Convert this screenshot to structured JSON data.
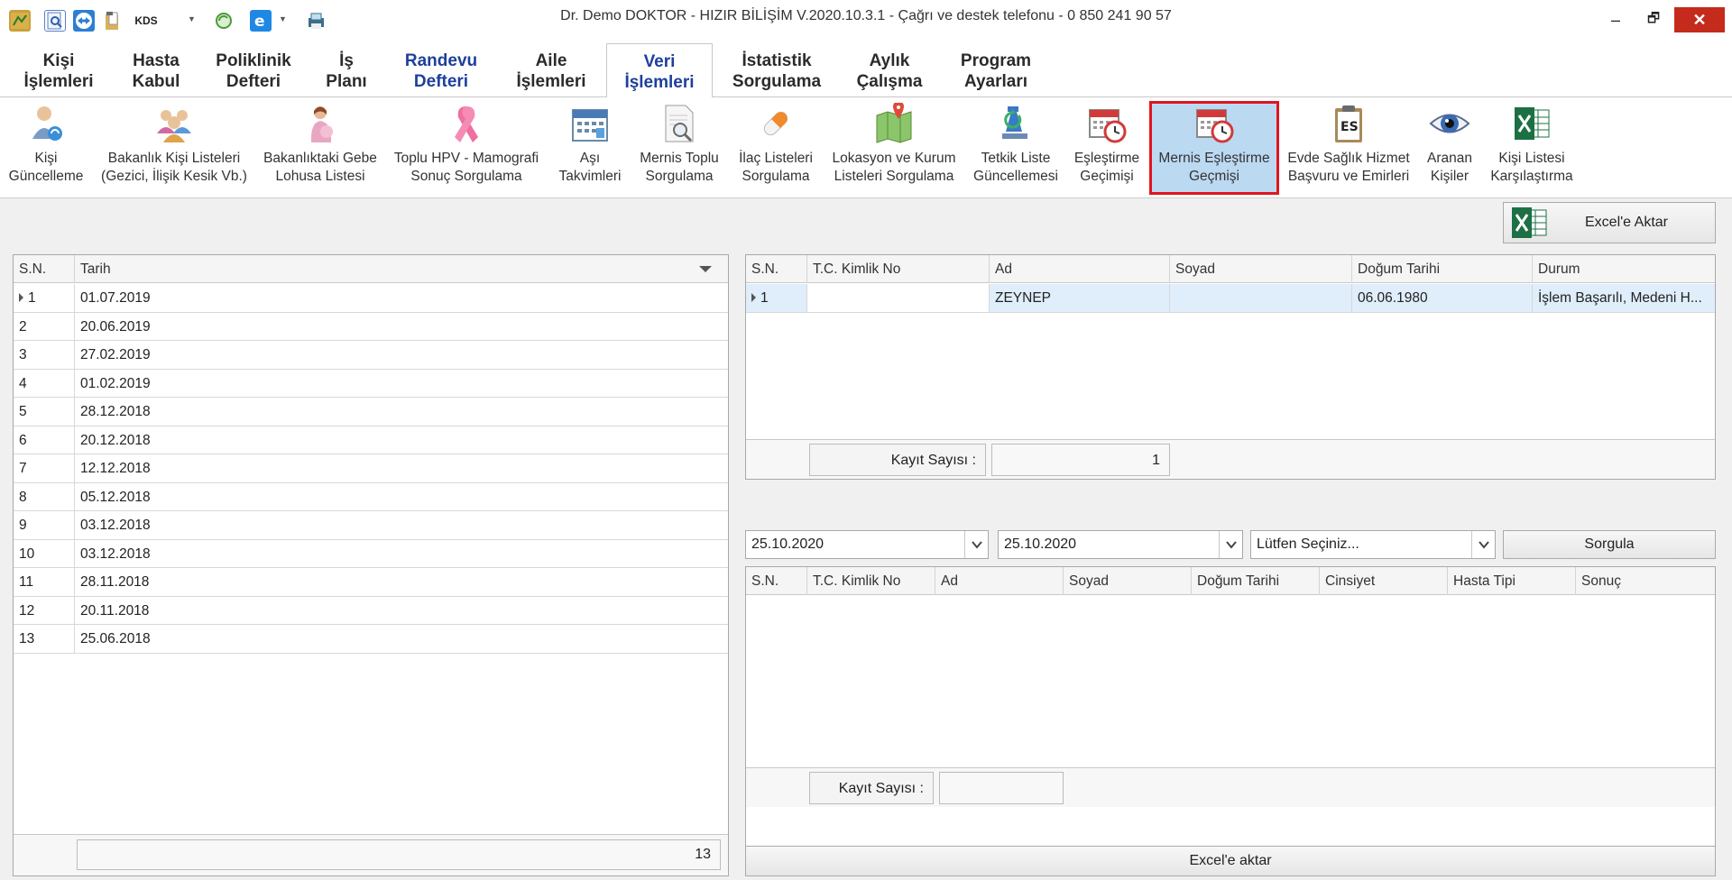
{
  "window": {
    "title": "Dr. Demo DOKTOR - HIZIR BİLİŞİM V.2020.10.3.1 - Çağrı ve destek telefonu - 0 850 241 90 57",
    "kds_label": "KDS",
    "minimize": "–",
    "restore": "🗗",
    "close": "✕"
  },
  "menu": {
    "tabs": [
      {
        "line1": "Kişi",
        "line2": "İşlemleri"
      },
      {
        "line1": "Hasta",
        "line2": "Kabul"
      },
      {
        "line1": "Poliklinik",
        "line2": "Defteri"
      },
      {
        "line1": "İş",
        "line2": "Planı"
      },
      {
        "line1": "Randevu",
        "line2": "Defteri"
      },
      {
        "line1": "Aile",
        "line2": "İşlemleri"
      },
      {
        "line1": "Veri",
        "line2": "İşlemleri"
      },
      {
        "line1": "İstatistik",
        "line2": "Sorgulama"
      },
      {
        "line1": "Aylık",
        "line2": "Çalışma"
      },
      {
        "line1": "Program",
        "line2": "Ayarları"
      }
    ],
    "active_tab": "Veri İşlemleri"
  },
  "ribbon": {
    "items": [
      {
        "line1": "Kişi",
        "line2": "Güncelleme",
        "icon": "person-update-icon"
      },
      {
        "line1": "Bakanlık Kişi Listeleri",
        "line2": "(Gezici, İlişik Kesik Vb.)",
        "icon": "people-group-icon"
      },
      {
        "line1": "Bakanlıktaki Gebe",
        "line2": "Lohusa Listesi",
        "icon": "pregnant-woman-icon"
      },
      {
        "line1": "Toplu HPV - Mamografi",
        "line2": "Sonuç Sorgulama",
        "icon": "pink-ribbon-icon"
      },
      {
        "line1": "Aşı",
        "line2": "Takvimleri",
        "icon": "calendar-icon"
      },
      {
        "line1": "Mernis Toplu",
        "line2": "Sorgulama",
        "icon": "document-search-icon"
      },
      {
        "line1": "İlaç Listeleri",
        "line2": "Sorgulama",
        "icon": "pill-icon"
      },
      {
        "line1": "Lokasyon ve Kurum",
        "line2": "Listeleri Sorgulama",
        "icon": "map-icon"
      },
      {
        "line1": "Tetkik Liste",
        "line2": "Güncellemesi",
        "icon": "lab-refresh-icon"
      },
      {
        "line1": "Eşleştirme",
        "line2": "Geçimişi",
        "icon": "calendar-clock-icon"
      },
      {
        "line1": "Mernis Eşleştirme",
        "line2": "Geçmişi",
        "icon": "calendar-clock-icon"
      },
      {
        "line1": "Evde Sağlık Hizmet",
        "line2": "Başvuru ve Emirleri",
        "icon": "clipboard-es-icon"
      },
      {
        "line1": "Aranan",
        "line2": "Kişiler",
        "icon": "eye-icon"
      },
      {
        "line1": "Kişi Listesi",
        "line2": "Karşılaştırma",
        "icon": "excel-icon"
      }
    ],
    "es_badge": "ES",
    "selected": "Mernis Eşleştirme Geçmişi"
  },
  "toolbar": {
    "excel_export_label": "Excel'e Aktar"
  },
  "left_grid": {
    "headers": [
      "S.N.",
      "Tarih"
    ],
    "rows": [
      {
        "sn": "1",
        "date": "01.07.2019"
      },
      {
        "sn": "2",
        "date": "20.06.2019"
      },
      {
        "sn": "3",
        "date": "27.02.2019"
      },
      {
        "sn": "4",
        "date": "01.02.2019"
      },
      {
        "sn": "5",
        "date": "28.12.2018"
      },
      {
        "sn": "6",
        "date": "20.12.2018"
      },
      {
        "sn": "7",
        "date": "12.12.2018"
      },
      {
        "sn": "8",
        "date": "05.12.2018"
      },
      {
        "sn": "9",
        "date": "03.12.2018"
      },
      {
        "sn": "10",
        "date": "03.12.2018"
      },
      {
        "sn": "11",
        "date": "28.11.2018"
      },
      {
        "sn": "12",
        "date": "20.11.2018"
      },
      {
        "sn": "13",
        "date": "25.06.2018"
      }
    ],
    "footer_count": "13"
  },
  "top_right_grid": {
    "headers": [
      "S.N.",
      "T.C. Kimlik No",
      "Ad",
      "Soyad",
      "Doğum Tarihi",
      "Durum"
    ],
    "rows": [
      {
        "sn": "1",
        "tc": "",
        "ad": "ZEYNEP",
        "soyad": "",
        "dogum": "06.06.1980",
        "durum": "İşlem Başarılı, Medeni H..."
      }
    ],
    "record_count_label": "Kayıt Sayısı :",
    "record_count_value": "1"
  },
  "filter": {
    "date_start": "25.10.2020",
    "date_end": "25.10.2020",
    "select_placeholder": "Lütfen Seçiniz...",
    "query_button": "Sorgula"
  },
  "bottom_right_grid": {
    "headers": [
      "S.N.",
      "T.C. Kimlik No",
      "Ad",
      "Soyad",
      "Doğum Tarihi",
      "Cinsiyet",
      "Hasta Tipi",
      "Sonuç"
    ],
    "rows": [],
    "record_count_label": "Kayıt Sayısı :",
    "record_count_value": ""
  },
  "bottom": {
    "excel_button": "Excel'e aktar"
  }
}
